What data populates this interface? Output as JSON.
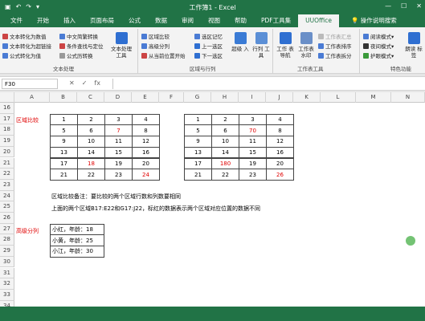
{
  "window": {
    "title": "工作簿1 - Excel"
  },
  "tabs": [
    "文件",
    "开始",
    "插入",
    "页面布局",
    "公式",
    "数据",
    "审阅",
    "视图",
    "帮助",
    "PDF工具集",
    "UUOffice",
    "操作说明搜索"
  ],
  "ribbon": {
    "text_group": {
      "items": [
        "文本转化为数值",
        "文本转化为超链接",
        "公式转化为值",
        "中文简繁转换",
        "条件查找与定位",
        "公式历转换"
      ],
      "big": "文本处理 工具",
      "label": "文本处理"
    },
    "area_group": {
      "items": [
        "区域比较",
        "高级分列",
        "从当前位置开始",
        "选区记忆",
        "上一选区",
        "下一选区"
      ],
      "big1": "超级 入",
      "big2": "行列 工具",
      "label": "区域与行列"
    },
    "book_group": {
      "big1": "工作 表导航",
      "big2": "工作表 水印",
      "items": [
        "工作表汇总",
        "工作表排序",
        "工作表拆分"
      ],
      "label": "工作表工具"
    },
    "special_group": {
      "items": [
        "阅读模式",
        "夜间模式",
        "护眼模式"
      ],
      "big": "朗读 标签",
      "label": "特色功能"
    }
  },
  "formula_bar": {
    "name_box": "F30",
    "formula": ""
  },
  "columns": [
    "A",
    "B",
    "C",
    "D",
    "E",
    "F",
    "G",
    "H",
    "I",
    "J",
    "K",
    "L",
    "M",
    "N"
  ],
  "rows": [
    "16",
    "17",
    "18",
    "19",
    "20",
    "21",
    "22",
    "23",
    "24",
    "25",
    "26",
    "27",
    "28",
    "29",
    "30",
    "31",
    "32",
    "33",
    "34"
  ],
  "sheet": {
    "label_compare": "区域比较",
    "label_split": "高级分列",
    "table1": [
      [
        "1",
        "2",
        "3",
        "4"
      ],
      [
        "5",
        "6",
        "7",
        "8"
      ],
      [
        "9",
        "10",
        "11",
        "12"
      ],
      [
        "13",
        "14",
        "15",
        "16"
      ],
      [
        "17",
        "18",
        "19",
        "20"
      ],
      [
        "21",
        "22",
        "23",
        "24"
      ]
    ],
    "table2": [
      [
        "1",
        "2",
        "3",
        "4"
      ],
      [
        "5",
        "6",
        "70",
        "8"
      ],
      [
        "9",
        "10",
        "11",
        "12"
      ],
      [
        "13",
        "14",
        "15",
        "16"
      ],
      [
        "17",
        "180",
        "19",
        "20"
      ],
      [
        "21",
        "22",
        "23",
        "26"
      ]
    ],
    "note1": "区域比较备注：要比较的两个区域行数和列数要相同",
    "note2": "上面的两个区域B17:E22和G17:J22，标红的数据表示两个区域对应位置的数据不同",
    "split_values": [
      "小红，年龄：18",
      "小黄，年龄：25",
      "小江，年龄：30"
    ]
  },
  "colors": {
    "excel_green": "#217346",
    "diff_red": "#e00000"
  }
}
